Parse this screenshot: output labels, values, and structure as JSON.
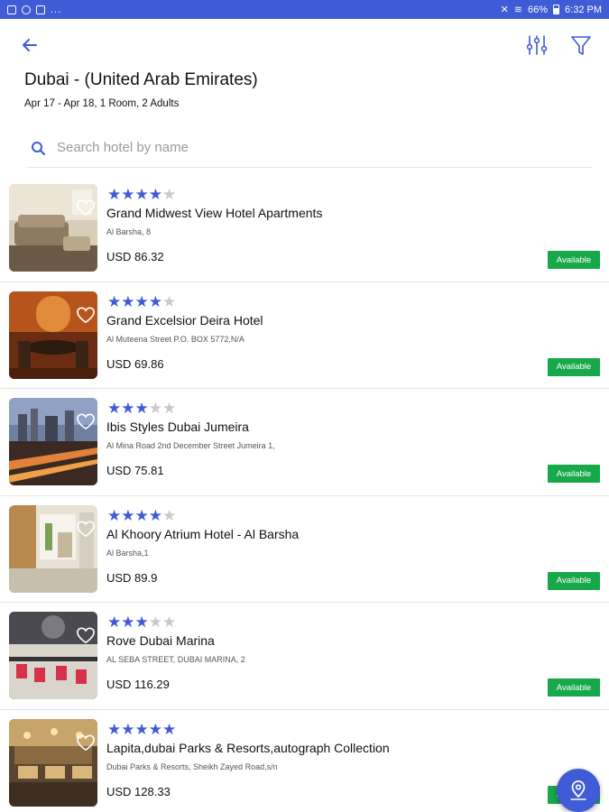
{
  "status_bar": {
    "left_icons": [
      "gallery-icon",
      "sync-icon",
      "download-icon"
    ],
    "left_dots": "...",
    "right_text": "66% ▮ 6:32 PM",
    "battery": "66%",
    "time": "6:32 PM"
  },
  "header": {
    "title": "Dubai - (United Arab Emirates)",
    "subtitle": "Apr 17 - Apr 18, 1 Room, 2 Adults"
  },
  "search": {
    "placeholder": "Search hotel by name",
    "value": ""
  },
  "colors": {
    "accent": "#3f5bd6",
    "available": "#17a84a",
    "star_off": "#c9c9c9"
  },
  "hotels": [
    {
      "rating": 4,
      "name": "Grand Midwest View Hotel Apartments",
      "address": "Al Barsha, 8",
      "price": "USD 86.32",
      "status": "Available",
      "image": "living-room-photo"
    },
    {
      "rating": 4,
      "name": "Grand Excelsior Deira Hotel",
      "address": "Al Muteena Street P.O. BOX 5772,N/A",
      "price": "USD 69.86",
      "status": "Available",
      "image": "lounge-photo"
    },
    {
      "rating": 3,
      "name": "Ibis Styles Dubai Jumeira",
      "address": "Al Mina Road  2nd December Street  Jumeira 1,",
      "price": "USD 75.81",
      "status": "Available",
      "image": "city-night-photo"
    },
    {
      "rating": 4,
      "name": "Al Khoory Atrium Hotel - Al Barsha",
      "address": "Al Barsha,1",
      "price": "USD 89.9",
      "status": "Available",
      "image": "lobby-photo"
    },
    {
      "rating": 3,
      "name": "Rove Dubai Marina",
      "address": "AL SEBA STREET, DUBAI MARINA, 2",
      "price": "USD 116.29",
      "status": "Available",
      "image": "restaurant-photo"
    },
    {
      "rating": 5,
      "name": "Lapita,dubai Parks & Resorts,autograph Collection",
      "address": "Dubai Parks & Resorts, Sheikh Zayed Road,s/n",
      "price": "USD 128.33",
      "status": "Available",
      "image": "resort-photo"
    }
  ]
}
